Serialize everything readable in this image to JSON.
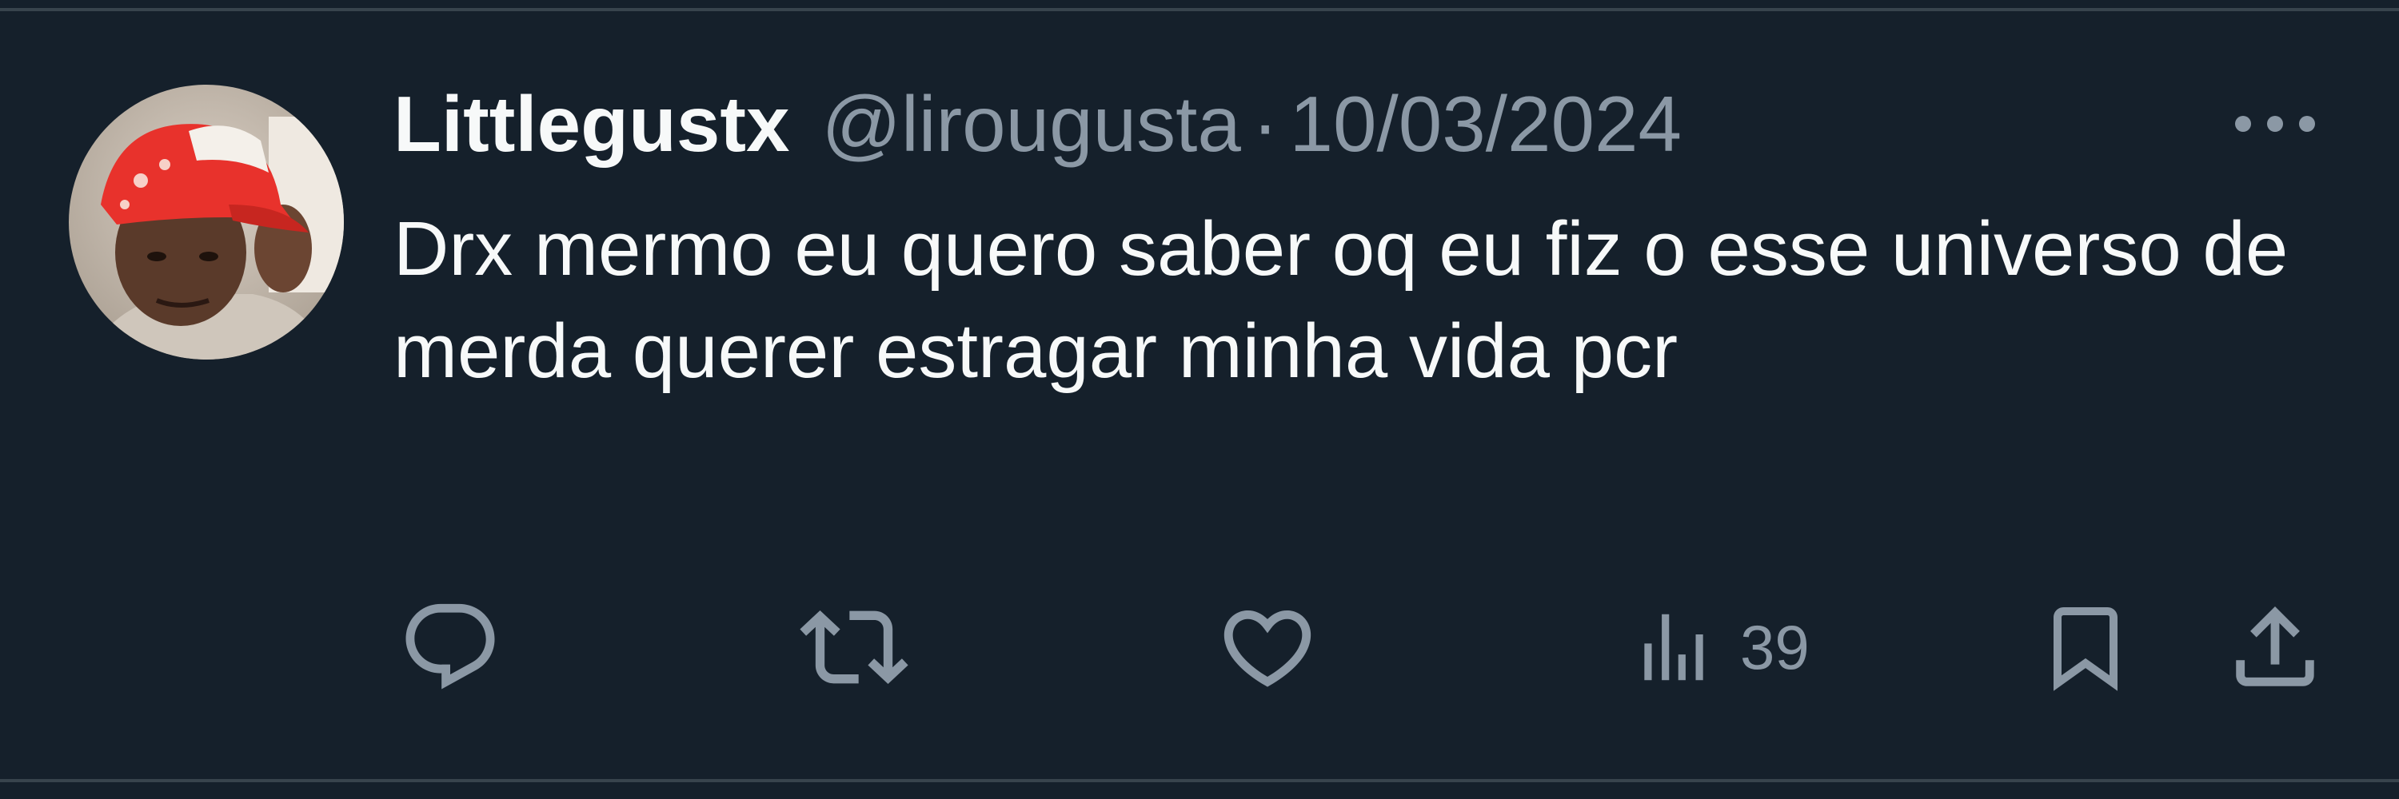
{
  "tweet": {
    "display_name": "Littlegustx",
    "handle": "@lirougusta",
    "separator": "·",
    "date": "10/03/2024",
    "text": "Drx mermo eu quero saber oq eu fiz o esse universo de merda querer estragar minha vida pcr"
  },
  "actions": {
    "reply": {
      "icon": "reply-icon"
    },
    "retweet": {
      "icon": "retweet-icon"
    },
    "like": {
      "icon": "heart-icon"
    },
    "views": {
      "icon": "analytics-icon",
      "count": "39"
    },
    "bookmark": {
      "icon": "bookmark-icon"
    },
    "share": {
      "icon": "share-icon"
    }
  },
  "colors": {
    "background": "#15202b",
    "primary_text": "#f7f9f9",
    "secondary_text": "#8b98a5",
    "divider": "#38444d",
    "avatar_cap": "#e8322c"
  }
}
